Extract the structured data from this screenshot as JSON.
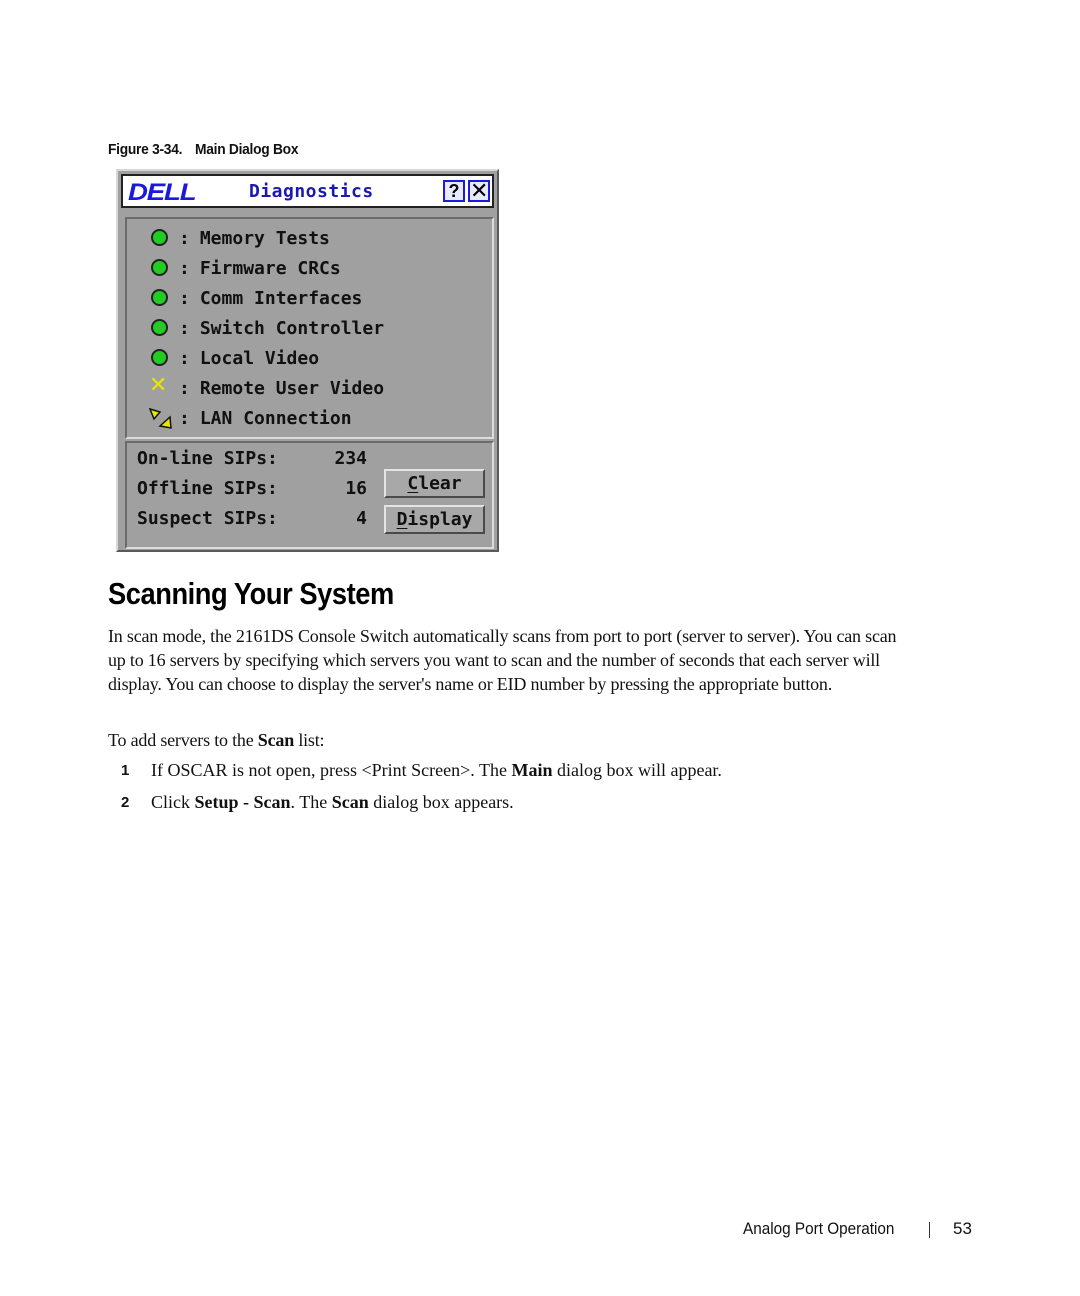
{
  "figure": {
    "number": "Figure 3-34.",
    "caption": "Main Dialog Box"
  },
  "dialog": {
    "logo": "DELL",
    "title": "Diagnostics",
    "help_label": "?",
    "close_label": "✕",
    "status_items": [
      {
        "icon": "green-led-icon",
        "status": "ok",
        "label": "Memory Tests"
      },
      {
        "icon": "green-led-icon",
        "status": "ok",
        "label": "Firmware CRCs"
      },
      {
        "icon": "green-led-icon",
        "status": "ok",
        "label": "Comm Interfaces"
      },
      {
        "icon": "green-led-icon",
        "status": "ok",
        "label": "Switch Controller"
      },
      {
        "icon": "green-led-icon",
        "status": "ok",
        "label": "Local Video"
      },
      {
        "icon": "yellow-x-icon",
        "status": "failed",
        "label": "Remote User Video"
      },
      {
        "icon": "lan-warning-icon",
        "status": "warning",
        "label": "LAN Connection"
      }
    ],
    "separator": ":",
    "sips": [
      {
        "label": "On-line SIPs:",
        "value": "234"
      },
      {
        "label": "Offline SIPs:",
        "value": "16"
      },
      {
        "label": "Suspect SIPs:",
        "value": "4"
      }
    ],
    "buttons": {
      "clear": {
        "accel": "C",
        "rest": "lear"
      },
      "display": {
        "accel": "D",
        "rest": "isplay"
      }
    },
    "colors": {
      "ok": "#22cc22",
      "failed": "#e6e600",
      "warning": "#e6e600",
      "title_text": "#1a1ab0",
      "logo": "#1a1adc",
      "background": "#a0a0a0"
    }
  },
  "section": {
    "heading": "Scanning Your System",
    "intro": "In scan mode, the 2161DS Console Switch automatically scans from port to port (server to server). You can scan up to 16 servers by specifying which servers you want to scan and the number of seconds that each server will display. You can choose to display the server's name or EID number by pressing the appropriate button.",
    "lead_prefix": "To add servers to the ",
    "lead_bold": "Scan",
    "lead_suffix": " list:",
    "steps": [
      {
        "number": "1",
        "parts": [
          {
            "text": "If OSCAR is not open, press <Print Screen>. The ",
            "bold": false
          },
          {
            "text": "Main",
            "bold": true
          },
          {
            "text": " dialog box will appear.",
            "bold": false
          }
        ]
      },
      {
        "number": "2",
        "parts": [
          {
            "text": "Click ",
            "bold": false
          },
          {
            "text": "Setup - Scan",
            "bold": true
          },
          {
            "text": ". The ",
            "bold": false
          },
          {
            "text": "Scan",
            "bold": true
          },
          {
            "text": " dialog box appears.",
            "bold": false
          }
        ]
      }
    ]
  },
  "footer": {
    "section": "Analog Port Operation",
    "page": "53"
  }
}
